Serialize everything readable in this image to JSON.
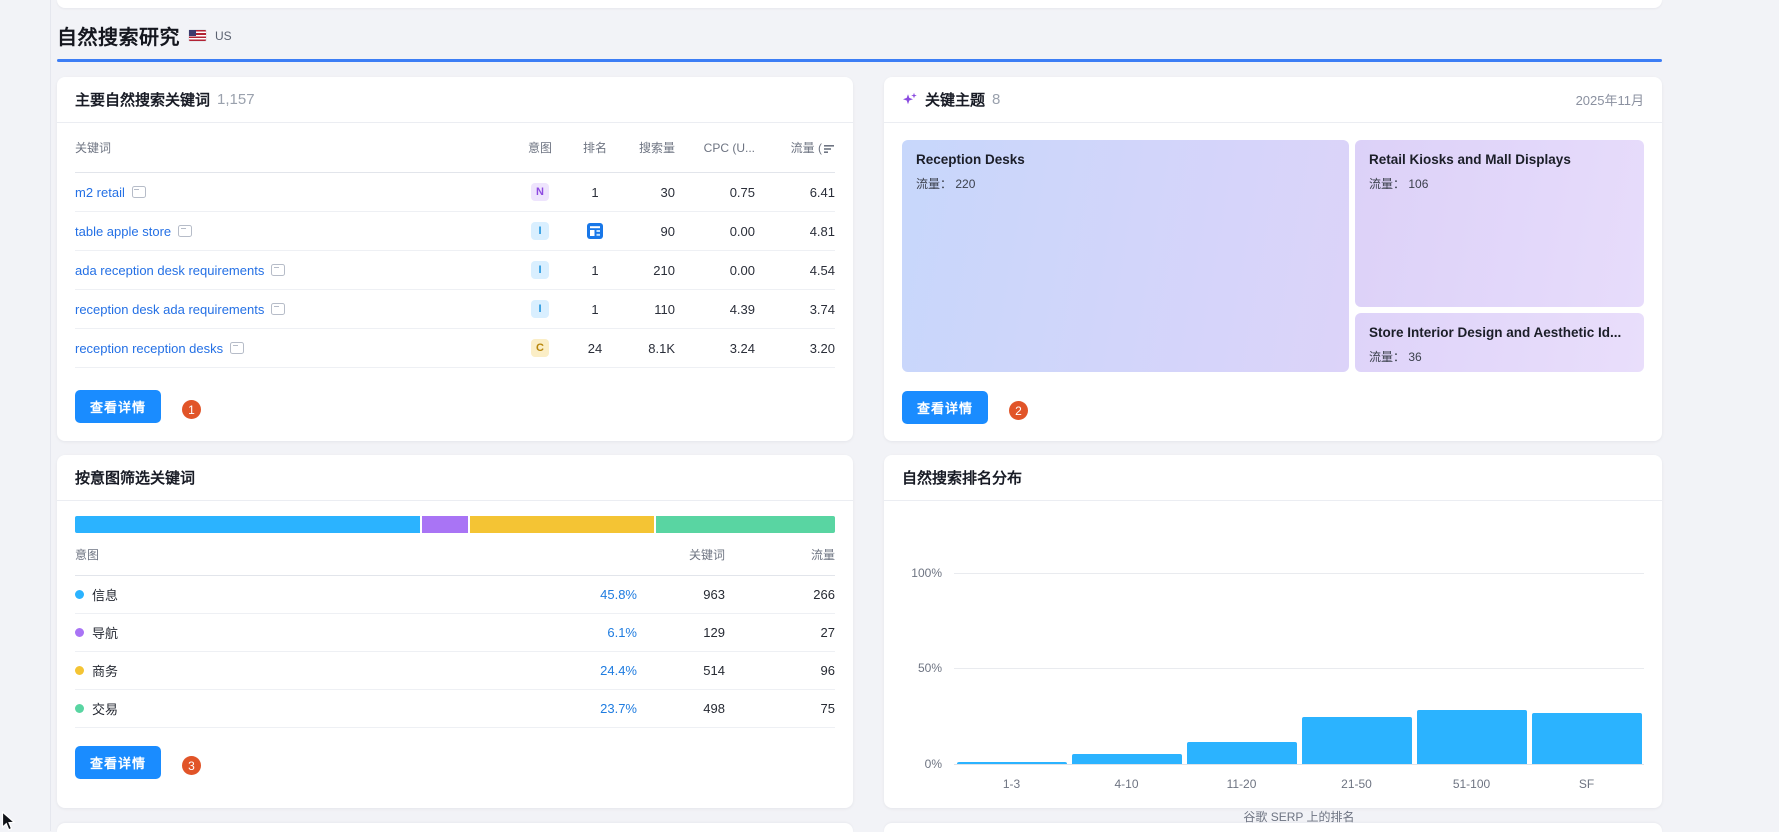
{
  "page": {
    "title": "自然搜索研究",
    "country": "US",
    "flag_icon": "us-flag-icon",
    "accent_color": "#3d7ef5"
  },
  "panels": {
    "keywords": {
      "title": "主要自然搜索关键词",
      "count": "1,157",
      "columns": {
        "keyword": "关键词",
        "intent": "意图",
        "rank": "排名",
        "volume": "搜索量",
        "cpc": "CPC (U...",
        "traffic": "流量 ("
      },
      "traffic_sort_icon": "sort-desc-icon",
      "rows": [
        {
          "keyword": "m2 retail",
          "intent": "N",
          "rank": "1",
          "volume": "30",
          "cpc": "0.75",
          "traffic": "6.41"
        },
        {
          "keyword": "table apple store",
          "intent": "I",
          "rank": "",
          "rank_icon": "featured-snippet-icon",
          "volume": "90",
          "cpc": "0.00",
          "traffic": "4.81"
        },
        {
          "keyword": "ada reception desk requirements",
          "intent": "I",
          "rank": "1",
          "volume": "210",
          "cpc": "0.00",
          "traffic": "4.54"
        },
        {
          "keyword": "reception desk ada requirements",
          "intent": "I",
          "rank": "1",
          "volume": "110",
          "cpc": "4.39",
          "traffic": "3.74"
        },
        {
          "keyword": "reception reception desks",
          "intent": "C",
          "rank": "24",
          "volume": "8.1K",
          "cpc": "3.24",
          "traffic": "3.20"
        }
      ],
      "view_details_label": "查看详情",
      "badge": "1"
    },
    "topics": {
      "icon": "sparkles-icon",
      "title": "关键主题",
      "count": "8",
      "date": "2025年11月",
      "traffic_label": "流量：",
      "cards": [
        {
          "name": "Reception Desks",
          "traffic": "220"
        },
        {
          "name": "Retail Kiosks and Mall Displays",
          "traffic": "106"
        },
        {
          "name": "Store Interior Design and Aesthetic Id...",
          "traffic": "36"
        }
      ],
      "view_details_label": "查看详情",
      "badge": "2"
    },
    "intent": {
      "title": "按意图筛选关键词",
      "columns": {
        "intent": "意图",
        "keywords": "关键词",
        "traffic": "流量"
      },
      "rows": [
        {
          "label": "信息",
          "percent": "45.8%",
          "keywords": "963",
          "traffic": "266",
          "color": "#2bb3ff"
        },
        {
          "label": "导航",
          "percent": "6.1%",
          "keywords": "129",
          "traffic": "27",
          "color": "#a974f5"
        },
        {
          "label": "商务",
          "percent": "24.4%",
          "keywords": "514",
          "traffic": "96",
          "color": "#f4c434"
        },
        {
          "label": "交易",
          "percent": "23.7%",
          "keywords": "498",
          "traffic": "75",
          "color": "#59d5a2"
        }
      ],
      "view_details_label": "查看详情",
      "badge": "3"
    },
    "ranking": {
      "title": "自然搜索排名分布"
    }
  },
  "chart_data": [
    {
      "type": "bar",
      "variant": "horizontal-stacked",
      "title": "按意图筛选关键词",
      "categories": [
        "信息",
        "导航",
        "商务",
        "交易"
      ],
      "values": [
        45.8,
        6.1,
        24.4,
        23.7
      ],
      "unit": "%",
      "colors": [
        "#2bb3ff",
        "#a974f5",
        "#f4c434",
        "#59d5a2"
      ],
      "legend_position": "table-below"
    },
    {
      "type": "bar",
      "title": "自然搜索排名分布",
      "categories": [
        "1-3",
        "4-10",
        "11-20",
        "21-50",
        "51-100",
        "SF"
      ],
      "values": [
        1,
        5,
        11.5,
        24.5,
        28.5,
        26.5
      ],
      "unit": "%",
      "xlabel": "谷歌 SERP 上的排名",
      "ylabel": "",
      "ylim": [
        0,
        100
      ],
      "yticks": [
        "0%",
        "50%",
        "100%"
      ],
      "grid": true,
      "legend": false,
      "bar_color": "#2bb3ff"
    }
  ]
}
